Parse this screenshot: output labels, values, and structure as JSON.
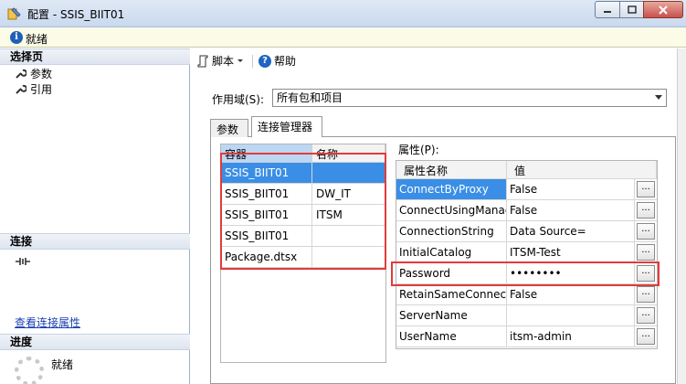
{
  "window": {
    "title": "配置 - SSIS_BIIT01"
  },
  "status": {
    "ready": "就绪"
  },
  "left_pane": {
    "select_page_header": "选择页",
    "pages": [
      {
        "label": "参数"
      },
      {
        "label": "引用"
      }
    ],
    "connection_header": "连接",
    "view_conn_props_link": "查看连接属性",
    "progress_header": "进度",
    "progress_status": "就绪"
  },
  "toolbar": {
    "script_label": "脚本",
    "help_label": "帮助"
  },
  "scope": {
    "label": "作用域(S):",
    "value": "所有包和项目"
  },
  "tabs": [
    {
      "label": "参数"
    },
    {
      "label": "连接管理器"
    }
  ],
  "conn_grid": {
    "headers": [
      "容器",
      "名称"
    ],
    "rows": [
      {
        "container": "SSIS_BIIT01",
        "name": ""
      },
      {
        "container": "SSIS_BIIT01",
        "name": "DW_IT"
      },
      {
        "container": "SSIS_BIIT01",
        "name": "ITSM"
      },
      {
        "container": "SSIS_BIIT01",
        "name": ""
      },
      {
        "container": "Package.dtsx",
        "name": ""
      }
    ]
  },
  "properties": {
    "label": "属性(P):",
    "headers": [
      "属性名称",
      "值"
    ],
    "button_label": "...",
    "rows": [
      {
        "name": "ConnectByProxy",
        "value": "False"
      },
      {
        "name": "ConnectUsingManag...",
        "value": "False"
      },
      {
        "name": "ConnectionString",
        "value": "Data Source="
      },
      {
        "name": "InitialCatalog",
        "value": "ITSM-Test"
      },
      {
        "name": "Password",
        "value": "••••••••"
      },
      {
        "name": "RetainSameConnection",
        "value": "False"
      },
      {
        "name": "ServerName",
        "value": ""
      },
      {
        "name": "UserName",
        "value": "itsm-admin"
      }
    ]
  }
}
